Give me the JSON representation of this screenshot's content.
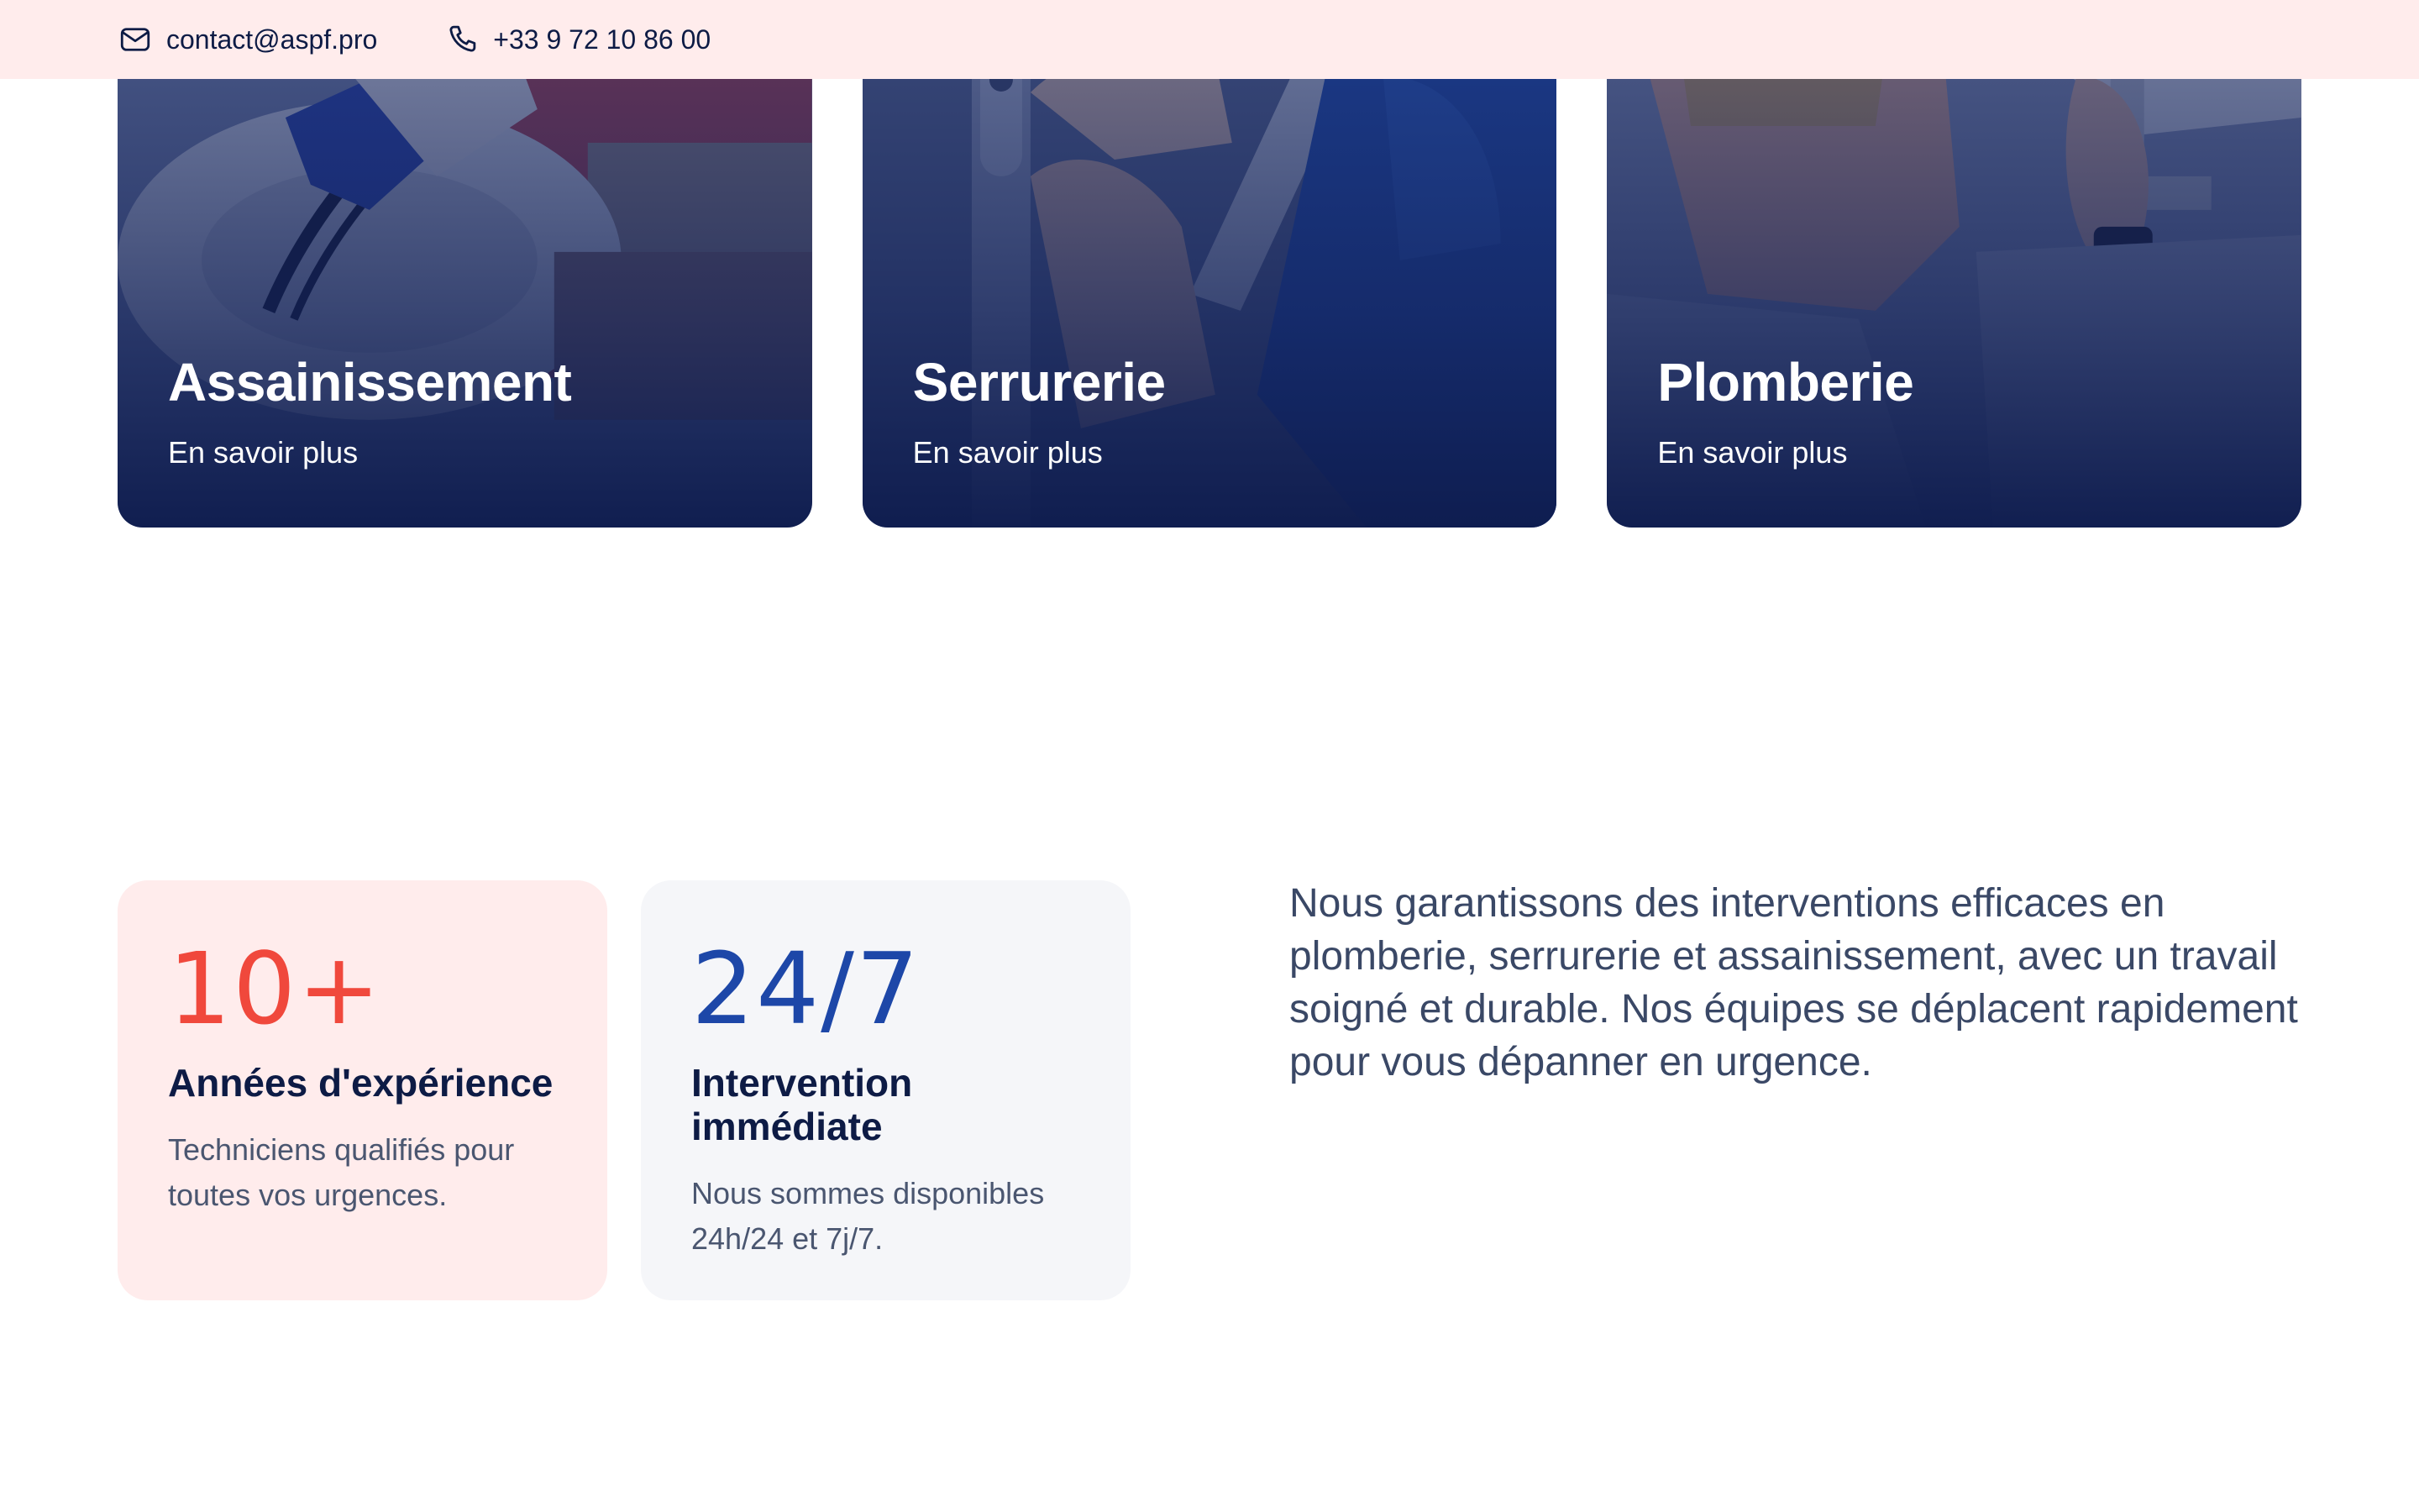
{
  "topbar": {
    "email": "contact@aspf.pro",
    "phone": "+33 9 72 10 86 00",
    "email_icon": "mail-icon",
    "phone_icon": "phone-icon"
  },
  "services": [
    {
      "title": "Assainissement",
      "link": "En savoir plus"
    },
    {
      "title": "Serrurerie",
      "link": "En savoir plus"
    },
    {
      "title": "Plomberie",
      "link": "En savoir plus"
    }
  ],
  "stats": [
    {
      "value": "10+",
      "title": "Années d'expérience",
      "text": "Techniciens qualifiés pour toutes vos urgences."
    },
    {
      "value": "24/7",
      "title": "Intervention immédiate",
      "text": "Nous sommes disponibles 24h/24 et 7j/7."
    }
  ],
  "description": "Nous garantissons des interventions efficaces en plomberie, serrurerie et assainissement, avec un travail soigné et durable. Nos équipes se déplacent rapidement pour vous dépanner en urgence.",
  "colors": {
    "topbar_bg": "#ffecec",
    "navy": "#0d1b45",
    "accent_red": "#f0483c",
    "accent_blue": "#1d47a8"
  }
}
